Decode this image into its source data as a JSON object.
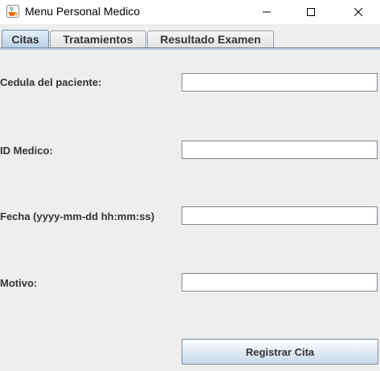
{
  "window": {
    "title": "Menu Personal Medico",
    "icon": "java-cup-icon"
  },
  "tabs": [
    {
      "label": "Citas",
      "selected": true
    },
    {
      "label": "Tratamientos",
      "selected": false
    },
    {
      "label": "Resultado Examen",
      "selected": false
    }
  ],
  "form": {
    "cedula_label": "Cedula del paciente:",
    "cedula_value": "",
    "id_medico_label": "ID Medico:",
    "id_medico_value": "",
    "fecha_label": "Fecha (yyyy-mm-dd hh:mm:ss)",
    "fecha_value": "",
    "motivo_label": "Motivo:",
    "motivo_value": "",
    "submit_label": "Registrar Cita"
  },
  "colors": {
    "background": "#eeeeee",
    "tab_active": "#b8cfe5",
    "border": "#7a8a99"
  }
}
